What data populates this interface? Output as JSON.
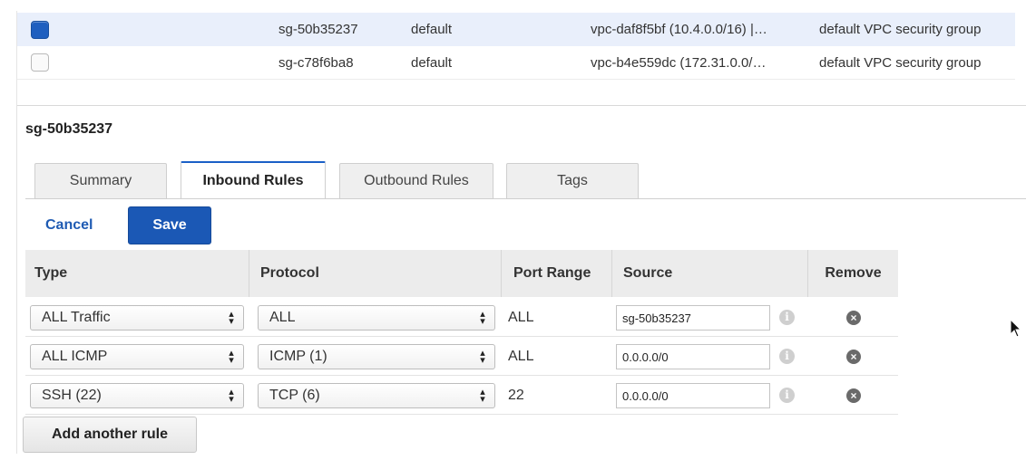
{
  "security_groups": [
    {
      "id": "sg-50b35237",
      "name": "default",
      "vpc": "vpc-daf8f5bf (10.4.0.0/16) |…",
      "description": "default VPC security group",
      "selected": true
    },
    {
      "id": "sg-c78f6ba8",
      "name": "default",
      "vpc": "vpc-b4e559dc (172.31.0.0/…",
      "description": "default VPC security group",
      "selected": false
    }
  ],
  "detail": {
    "title": "sg-50b35237"
  },
  "tabs": [
    {
      "label": "Summary"
    },
    {
      "label": "Inbound Rules",
      "active": true
    },
    {
      "label": "Outbound Rules"
    },
    {
      "label": "Tags"
    }
  ],
  "actions": {
    "cancel_label": "Cancel",
    "save_label": "Save",
    "add_rule_label": "Add another rule"
  },
  "rules_table": {
    "headers": {
      "type": "Type",
      "protocol": "Protocol",
      "port_range": "Port Range",
      "source": "Source",
      "remove": "Remove"
    },
    "rows": [
      {
        "type": "ALL Traffic",
        "protocol": "ALL",
        "port_range": "ALL",
        "source": "sg-50b35237"
      },
      {
        "type": "ALL ICMP",
        "protocol": "ICMP (1)",
        "port_range": "ALL",
        "source": "0.0.0.0/0"
      },
      {
        "type": "SSH (22)",
        "protocol": "TCP (6)",
        "port_range": "22",
        "source": "0.0.0.0/0"
      }
    ]
  },
  "icons": {
    "info": "info-icon",
    "remove": "remove-circle-icon",
    "dropdown": "dropdown-arrow-icon",
    "cursor": "mouse-pointer-icon"
  },
  "colors": {
    "accent": "#1b58b5",
    "selected_row": "#e9effb",
    "header_bg": "#ececec"
  }
}
